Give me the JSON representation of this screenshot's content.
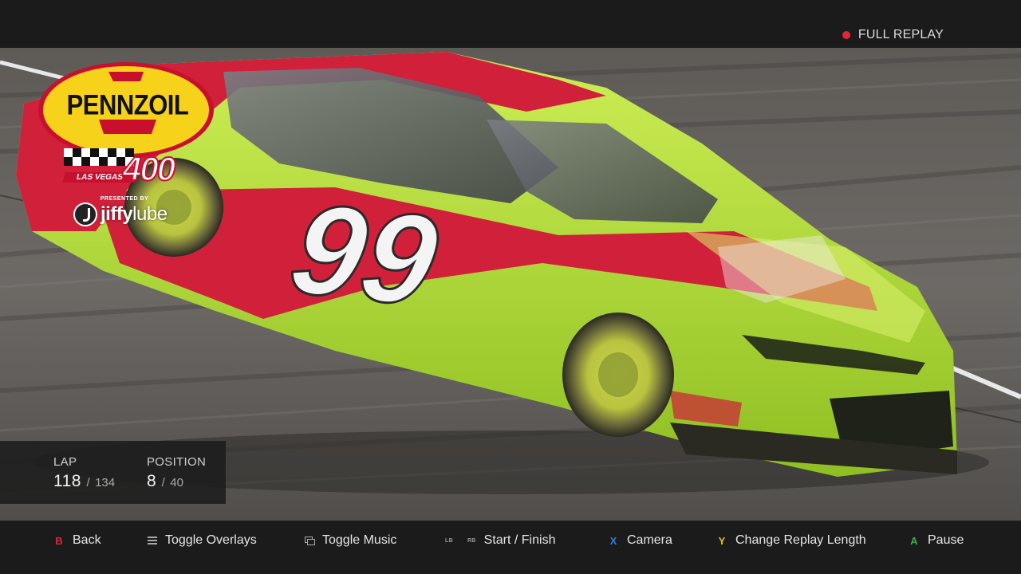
{
  "top_bar": {
    "replay_label": "FULL REPLAY",
    "status_color": "#e3263a"
  },
  "event_logo": {
    "brand": "PENNZOIL",
    "venue": "LAS VEGAS",
    "race": "400",
    "presented_by": "PRESENTED BY",
    "sponsor_part1": "jiffy",
    "sponsor_part2": "lube",
    "colors": {
      "badge": "#f6d21b",
      "border": "#c8102e"
    }
  },
  "car": {
    "number": "99",
    "body_color": "#b9e43b",
    "accent_color": "#d0203a"
  },
  "stats": {
    "lap_label": "LAP",
    "lap_current": "118",
    "lap_separator": "/",
    "lap_total": "134",
    "position_label": "POSITION",
    "position_current": "8",
    "position_separator": "/",
    "position_total": "40"
  },
  "controls": {
    "back": {
      "glyph": "B",
      "label": "Back"
    },
    "toggle_overlays": {
      "glyph": "menu-icon",
      "label": "Toggle Overlays"
    },
    "toggle_music": {
      "glyph": "view-icon",
      "label": "Toggle Music"
    },
    "start_finish": {
      "glyph_left": "LB",
      "glyph_right": "RB",
      "label": "Start / Finish"
    },
    "camera": {
      "glyph": "X",
      "label": "Camera"
    },
    "change_replay_length": {
      "glyph": "Y",
      "label": "Change Replay Length"
    },
    "pause": {
      "glyph": "A",
      "label": "Pause"
    }
  }
}
